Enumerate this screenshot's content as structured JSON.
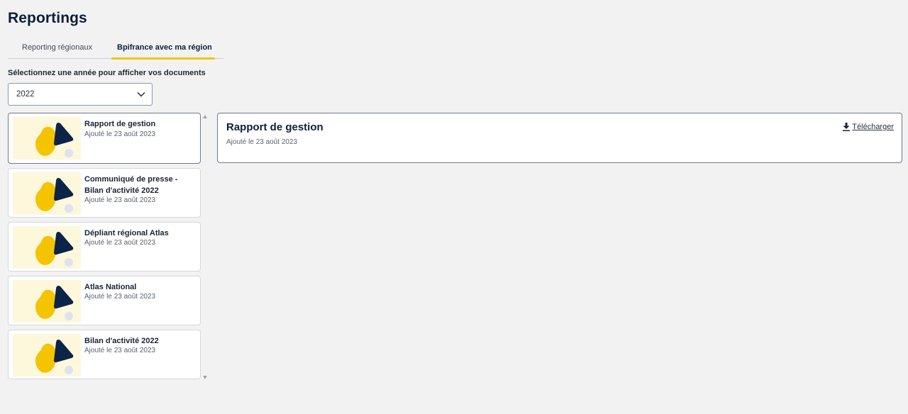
{
  "page": {
    "title": "Reportings"
  },
  "tabs": [
    {
      "label": "Reporting régionaux",
      "active": false
    },
    {
      "label": "Bpifrance avec ma région",
      "active": true
    }
  ],
  "year_filter": {
    "label": "Sélectionnez une année pour afficher vos documents",
    "selected": "2022"
  },
  "documents": [
    {
      "title": "Rapport de gestion",
      "date": "Ajouté le 23 août 2023",
      "selected": true
    },
    {
      "title": "Communiqué de presse - Bilan d'activité 2022",
      "date": "Ajouté le 23 août 2023",
      "selected": false
    },
    {
      "title": "Dépliant régional Atlas",
      "date": "Ajouté le 23 août 2023",
      "selected": false
    },
    {
      "title": "Atlas National",
      "date": "Ajouté le 23 août 2023",
      "selected": false
    },
    {
      "title": "Bilan d'activité 2022",
      "date": "Ajouté le 23 août 2023",
      "selected": false
    }
  ],
  "detail": {
    "title": "Rapport de gestion",
    "date": "Ajouté le 23 août 2023",
    "download_label": "Télécharger",
    "download_icon": "download-icon"
  },
  "colors": {
    "accent_yellow": "#f5c400",
    "navy": "#0b1f3a",
    "thumb_bg": "#fdf7dc"
  }
}
